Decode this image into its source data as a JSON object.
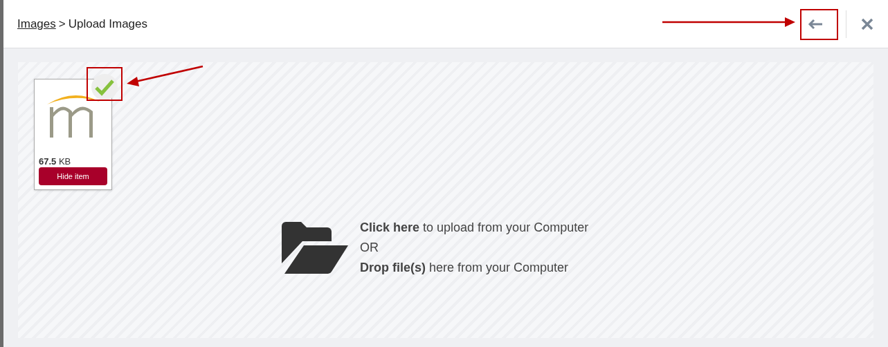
{
  "breadcrumb": {
    "link": "Images",
    "separator": ">",
    "current": "Upload Images"
  },
  "files": [
    {
      "size": "**67.5** KB",
      "button": "Hide item",
      "uploaded": true
    }
  ],
  "dropzone": {
    "lines": [
      {
        "kind": "text",
        "text": "**Click here** to upload from your Computer"
      },
      {
        "kind": "text",
        "text": "OR"
      },
      {
        "kind": "text",
        "text": "**Drop file(s)** here from your Computer"
      }
    ]
  }
}
